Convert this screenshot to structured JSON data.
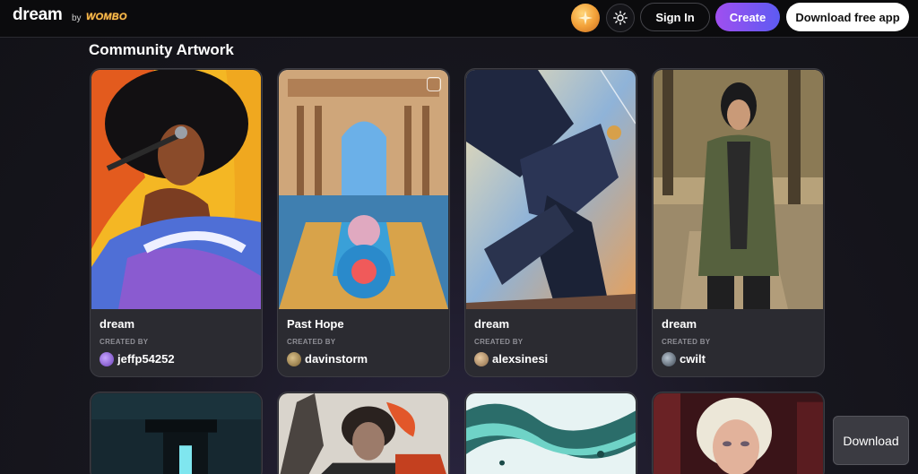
{
  "header": {
    "logo": "dream",
    "by": "by",
    "brand": "WOMBO",
    "sign_in": "Sign In",
    "create": "Create",
    "download_app": "Download free app"
  },
  "section": {
    "title": "Community Artwork"
  },
  "cards": [
    {
      "title": "dream",
      "created_label": "CREATED BY",
      "user": "jeffp54252"
    },
    {
      "title": "Past Hope",
      "created_label": "CREATED BY",
      "user": "davinstorm"
    },
    {
      "title": "dream",
      "created_label": "CREATED BY",
      "user": "alexsinesi"
    },
    {
      "title": "dream",
      "created_label": "CREATED BY",
      "user": "cwilt"
    }
  ],
  "floating": {
    "download": "Download"
  },
  "colors": {
    "accent_gradient_start": "#a04ff0",
    "accent_gradient_end": "#5d5bf2",
    "card_bg": "#2b2b31"
  }
}
